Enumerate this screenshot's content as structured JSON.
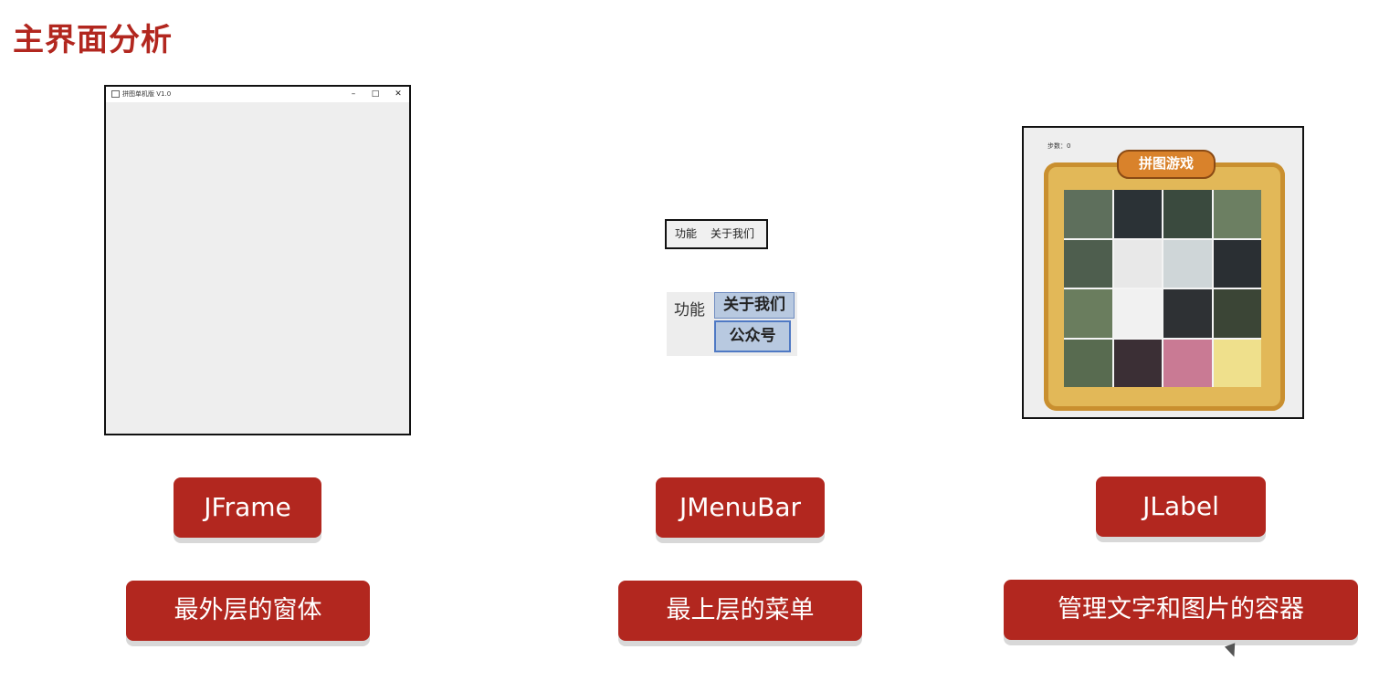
{
  "page": {
    "title": "主界面分析"
  },
  "jframe_mockup": {
    "window_title": "拼图单机版 V1.0",
    "controls": [
      "–",
      "□",
      "✕"
    ]
  },
  "menubar_mockup": {
    "small": {
      "items": [
        "功能",
        "关于我们"
      ]
    },
    "big": {
      "items": [
        "功能",
        "关于我们"
      ],
      "popup_item": "公众号"
    }
  },
  "jlabel_mockup": {
    "steps_text": "步数：0",
    "banner_text": "拼图游戏"
  },
  "components": [
    {
      "name": "JFrame",
      "description": "最外层的窗体"
    },
    {
      "name": "JMenuBar",
      "description": "最上层的菜单"
    },
    {
      "name": "JLabel",
      "description": "管理文字和图片的容器"
    }
  ],
  "colors": {
    "accent": "#b2271f",
    "menu_highlight": "#b8c9e0"
  }
}
